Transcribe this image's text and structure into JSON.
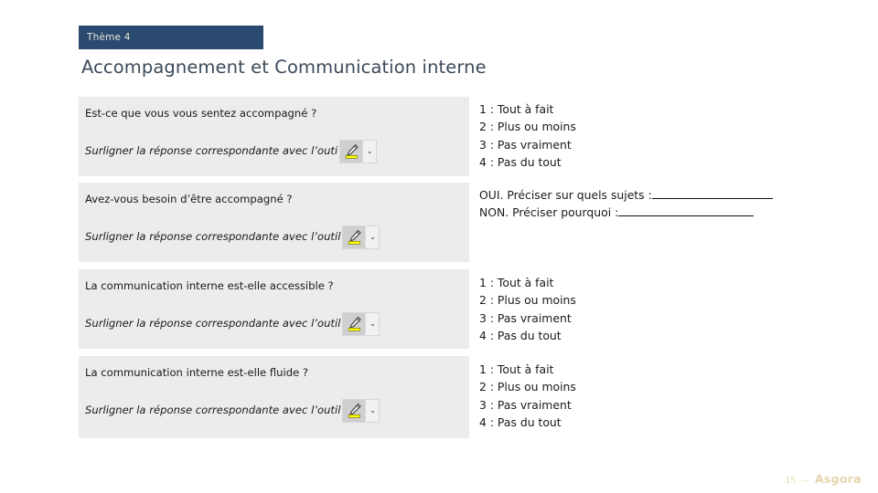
{
  "slide": {
    "theme_label": "Thème 4",
    "title": "Accompagnement et Communication interne",
    "theme_banner_color": "#2b4a6f",
    "title_color": "#3b4a5a",
    "block_background": "#ececec"
  },
  "blocks": [
    {
      "question": "Est-ce que vous vous sentez accompagné ?",
      "instruction": "Surligner la réponse correspondante avec l’outi",
      "tool": {
        "icon": "highlighter-icon",
        "caret": "⌄",
        "highlight_color": "#ffff00"
      }
    },
    {
      "question": "Avez-vous besoin d’être accompagné ?",
      "instruction": "Surligner la réponse correspondante avec l’outil",
      "tool": {
        "icon": "highlighter-icon",
        "caret": "⌄",
        "highlight_color": "#ffff00"
      }
    },
    {
      "question": "La communication interne est-elle accessible ?",
      "instruction": "Surligner la réponse correspondante avec l’outil",
      "tool": {
        "icon": "highlighter-icon",
        "caret": "⌄",
        "highlight_color": "#ffff00"
      }
    },
    {
      "question": "La communication interne est-elle fluide ?",
      "instruction": "Surligner la réponse correspondante avec l’outil",
      "tool": {
        "icon": "highlighter-icon",
        "caret": "⌄",
        "highlight_color": "#ffff00"
      }
    }
  ],
  "answers": [
    {
      "type": "scale",
      "lines": [
        "1 : Tout à fait",
        "2 : Plus ou moins",
        "3 : Pas vraiment",
        "4 : Pas du tout"
      ]
    },
    {
      "type": "freetext",
      "lines": [
        "OUI. Préciser sur quels sujets :",
        "NON. Préciser pourquoi :"
      ]
    },
    {
      "type": "scale",
      "lines": [
        "1 : Tout à fait",
        "2 : Plus ou moins",
        "3 : Pas vraiment",
        "4 : Pas du tout"
      ]
    },
    {
      "type": "scale",
      "lines": [
        "1 : Tout à fait",
        "2 : Plus ou moins",
        "3 : Pas vraiment",
        "4 : Pas du tout"
      ]
    }
  ],
  "footer": {
    "page_number": "15",
    "separator": "—",
    "brand": "Asgora",
    "color": "#e6d6ae"
  }
}
